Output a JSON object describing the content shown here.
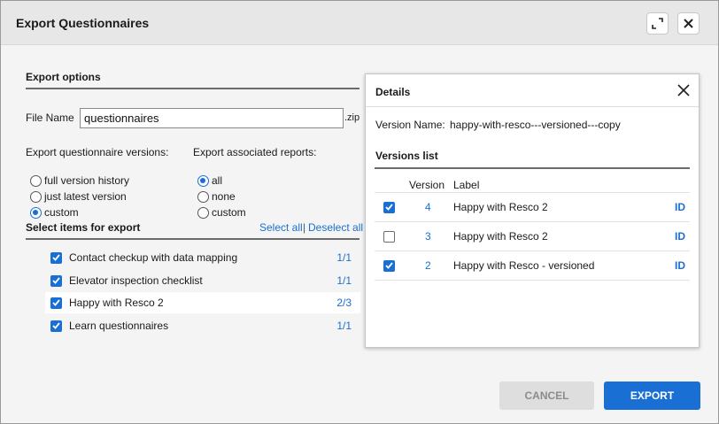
{
  "dialog": {
    "title": "Export Questionnaires",
    "expand_icon": "expand-icon",
    "close_icon": "close-icon"
  },
  "export_options": {
    "title": "Export options",
    "file_name_label": "File Name",
    "file_name_value": "questionnaires",
    "file_ext": ".zip",
    "versions_label": "Export questionnaire versions:",
    "versions": [
      {
        "label": "full version history",
        "selected": false
      },
      {
        "label": "just latest version",
        "selected": false
      },
      {
        "label": "custom",
        "selected": true
      }
    ],
    "reports_label": "Export associated reports:",
    "reports": [
      {
        "label": "all",
        "selected": true
      },
      {
        "label": "none",
        "selected": false
      },
      {
        "label": "custom",
        "selected": false
      }
    ]
  },
  "select_items": {
    "title": "Select items for export",
    "select_all": "Select all",
    "separator": "|",
    "deselect_all": "Deselect all",
    "items": [
      {
        "label": "Contact checkup with data mapping",
        "count": "1/1",
        "checked": true
      },
      {
        "label": "Elevator inspection checklist",
        "count": "1/1",
        "checked": true
      },
      {
        "label": "Happy with Resco 2",
        "count": "2/3",
        "checked": true
      },
      {
        "label": "Learn questionnaires",
        "count": "1/1",
        "checked": true
      }
    ]
  },
  "details": {
    "title": "Details",
    "version_name_label": "Version Name:",
    "version_name_value": "happy-with-resco---versioned---copy",
    "versions_list_title": "Versions list",
    "col_version": "Version",
    "col_label": "Label",
    "rows": [
      {
        "version": "4",
        "label": "Happy with Resco 2",
        "id": "ID",
        "checked": true
      },
      {
        "version": "3",
        "label": "Happy with Resco 2",
        "id": "ID",
        "checked": false
      },
      {
        "version": "2",
        "label": "Happy with Resco - versioned",
        "id": "ID",
        "checked": true
      }
    ]
  },
  "footer": {
    "cancel": "CANCEL",
    "export": "EXPORT"
  },
  "colors": {
    "accent": "#1a6fd4",
    "disabled_button": "#dedede",
    "header_bg": "#e7e7e7"
  }
}
